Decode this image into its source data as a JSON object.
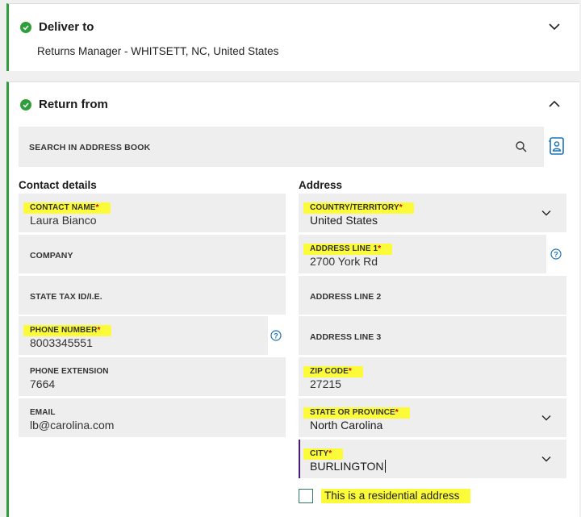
{
  "deliver": {
    "title": "Deliver to",
    "summary": "Returns Manager - WHITSETT, NC, United States"
  },
  "return_from": {
    "title": "Return from",
    "search_label": "SEARCH IN ADDRESS BOOK",
    "contact_heading": "Contact details",
    "address_heading": "Address",
    "required_mark": "*"
  },
  "contact": {
    "name": {
      "label": "CONTACT NAME",
      "value": "Laura Bianco"
    },
    "company": {
      "label": "COMPANY"
    },
    "tax_id": {
      "label": "STATE TAX ID/I.E."
    },
    "phone": {
      "label": "PHONE NUMBER",
      "value": "8003345551"
    },
    "extension": {
      "label": "PHONE EXTENSION",
      "value": "7664"
    },
    "email": {
      "label": "EMAIL",
      "value": "lb@carolina.com"
    }
  },
  "address": {
    "country": {
      "label": "COUNTRY/TERRITORY",
      "value": "United States"
    },
    "line1": {
      "label": "ADDRESS LINE 1",
      "value": "2700 York Rd"
    },
    "line2": {
      "label": "ADDRESS LINE 2"
    },
    "line3": {
      "label": "ADDRESS LINE 3"
    },
    "zip": {
      "label": "ZIP CODE",
      "value": "27215"
    },
    "state": {
      "label": "STATE OR PROVINCE",
      "value": "North Carolina"
    },
    "city": {
      "label": "CITY",
      "value": "BURLINGTON"
    },
    "residential_label": "This is a residential address"
  },
  "colors": {
    "accent_green": "#2e9e3a",
    "highlight": "#fbfb3a",
    "required": "#d3000a",
    "help_blue": "#1a73b8"
  },
  "icons": [
    "check-circle-icon",
    "chevron-down-icon",
    "chevron-up-icon",
    "search-icon",
    "address-book-icon",
    "help-icon"
  ]
}
